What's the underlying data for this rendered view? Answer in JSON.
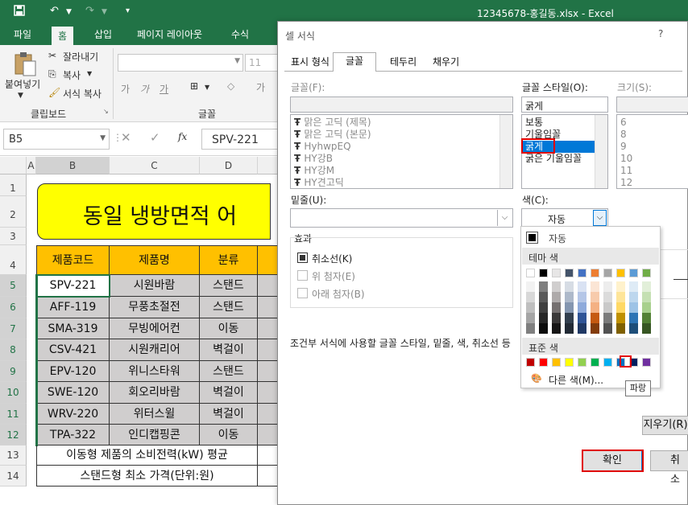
{
  "qat": {
    "save_icon": "save-icon",
    "undo_icon": "undo-icon",
    "redo_icon": "redo-icon",
    "customize_icon": "customize-icon",
    "title": "12345678-홍길동.xlsx  -  Excel"
  },
  "ribbon_tabs": [
    "파일",
    "홈",
    "삽입",
    "페이지 레이아웃",
    "수식"
  ],
  "ribbon": {
    "paste": "붙여넣기",
    "cut": "잘라내기",
    "copy": "복사",
    "format_painter": "서식 복사",
    "clipboard_group": "클립보드",
    "font_group": "글꼴",
    "font_size": "11"
  },
  "formula_bar": {
    "name_box": "B5",
    "fx": "fx",
    "value": "SPV-221"
  },
  "columns": [
    "A",
    "B",
    "C",
    "D"
  ],
  "rows": [
    "1",
    "2",
    "3",
    "4",
    "5",
    "6",
    "7",
    "8",
    "9",
    "10",
    "11",
    "12",
    "13",
    "14"
  ],
  "sheet": {
    "title": "동일 냉방면적 어",
    "headers": [
      "제품코드",
      "제품명",
      "분류"
    ],
    "data": [
      [
        "SPV-221",
        "시원바람",
        "스탠드"
      ],
      [
        "AFF-119",
        "무풍초절전",
        "스탠드"
      ],
      [
        "SMA-319",
        "무빙에어컨",
        "이동"
      ],
      [
        "CSV-421",
        "시원캐리어",
        "벽걸이"
      ],
      [
        "EPV-120",
        "위니스타워",
        "스탠드"
      ],
      [
        "SWE-120",
        "회오리바람",
        "벽걸이"
      ],
      [
        "WRV-220",
        "위터스윌",
        "벽걸이"
      ],
      [
        "TPA-322",
        "인디캡핑콘",
        "이동"
      ]
    ],
    "row13": "이동형 제품의 소비전력(kW) 평균",
    "row14": "스탠드형 최소 가격(단위:원)"
  },
  "dialog": {
    "title": "셀 서식",
    "help": "?",
    "tabs": [
      "표시 형식",
      "글꼴",
      "테두리",
      "채우기"
    ],
    "font_label": "글꼴(F):",
    "fonts": [
      "맑은 고딕 (제목)",
      "맑은 고딕 (본문)",
      "HyhwpEQ",
      "HY강B",
      "HY강M",
      "HY견고딕"
    ],
    "style_label": "글꼴 스타일(O):",
    "style_value": "굵게",
    "styles": [
      "보통",
      "기울임꼴",
      "굵게",
      "굵은 기울임꼴"
    ],
    "size_label": "크기(S):",
    "sizes": [
      "6",
      "8",
      "9",
      "10",
      "11",
      "12"
    ],
    "underline_label": "밑줄(U):",
    "color_label": "색(C):",
    "color_value": "자동",
    "effects_label": "효과",
    "strike": "취소선(K)",
    "superscript": "위 첨자(E)",
    "subscript": "아래 첨자(B)",
    "info": "조건부 서식에 사용할 글꼴 스타일, 밑줄, 색, 취소선 등",
    "clear": "지우기(R)",
    "ok": "확인",
    "cancel": "취소"
  },
  "popup": {
    "auto": "자동",
    "theme": "테마 색",
    "standard": "표준 색",
    "more": "다른 색(M)...",
    "tooltip": "파랑"
  },
  "colors": {
    "excel_green": "#217346",
    "yellow": "#ffff00",
    "header_orange": "#ffc000",
    "gray_cell": "#d0cece",
    "selected_blue": "#0070c0"
  }
}
